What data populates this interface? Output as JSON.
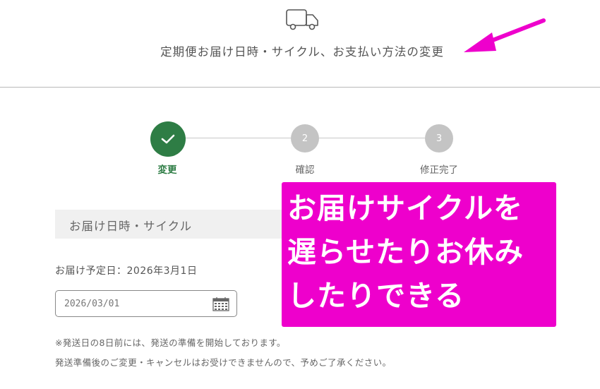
{
  "header": {
    "icon": "truck-icon",
    "title": "定期便お届け日時・サイクル、お支払い方法の変更"
  },
  "annotation": {
    "arrow_icon": "arrow-pointer-icon",
    "color": "#ee00cc",
    "callout_lines": [
      "お届けサイクルを",
      "遅らせたりお休み",
      "したりできる"
    ]
  },
  "stepper": {
    "steps": [
      {
        "number": "",
        "label": "変更",
        "state": "done"
      },
      {
        "number": "2",
        "label": "確認",
        "state": "pending"
      },
      {
        "number": "3",
        "label": "修正完了",
        "state": "pending"
      }
    ],
    "active_color": "#2e7d45",
    "inactive_color": "#c4c4c4"
  },
  "form": {
    "section_title": "お届け日時・サイクル",
    "scheduled_date_text": "お届け予定日：2026年3月1日",
    "date_input_value": "2026/03/01",
    "calendar_icon": "calendar-icon",
    "notes": [
      "※発送日の8日前には、発送の準備を開始しております。",
      "発送準備後のご変更・キャンセルはお受けできませんので、予めご了承ください。"
    ]
  }
}
